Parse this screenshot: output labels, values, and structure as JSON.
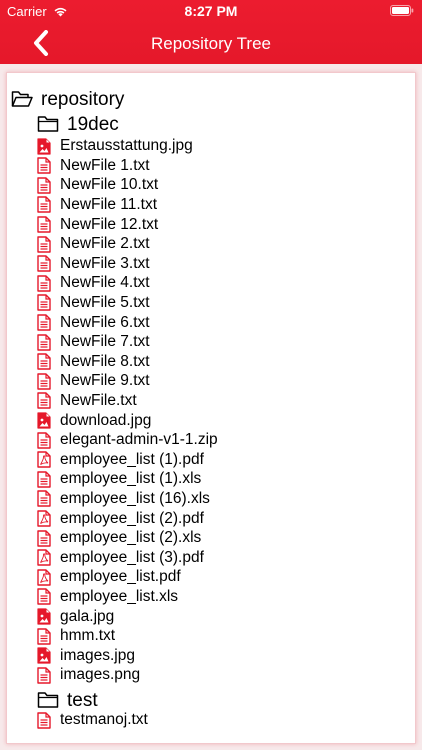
{
  "status_bar": {
    "carrier": "Carrier",
    "time": "8:27 PM"
  },
  "header": {
    "title": "Repository Tree",
    "accent_color": "#e5182a"
  },
  "tree": {
    "root": {
      "name": "repository",
      "icon": "folder-open-icon"
    },
    "folders": [
      {
        "name": "19dec",
        "icon": "folder-icon",
        "files": [
          {
            "name": "Erstausstattung.jpg",
            "icon": "image-file-icon"
          },
          {
            "name": "NewFile 1.txt",
            "icon": "text-file-icon"
          },
          {
            "name": "NewFile 10.txt",
            "icon": "text-file-icon"
          },
          {
            "name": "NewFile 11.txt",
            "icon": "text-file-icon"
          },
          {
            "name": "NewFile 12.txt",
            "icon": "text-file-icon"
          },
          {
            "name": "NewFile 2.txt",
            "icon": "text-file-icon"
          },
          {
            "name": "NewFile 3.txt",
            "icon": "text-file-icon"
          },
          {
            "name": "NewFile 4.txt",
            "icon": "text-file-icon"
          },
          {
            "name": "NewFile 5.txt",
            "icon": "text-file-icon"
          },
          {
            "name": "NewFile 6.txt",
            "icon": "text-file-icon"
          },
          {
            "name": "NewFile 7.txt",
            "icon": "text-file-icon"
          },
          {
            "name": "NewFile 8.txt",
            "icon": "text-file-icon"
          },
          {
            "name": "NewFile 9.txt",
            "icon": "text-file-icon"
          },
          {
            "name": "NewFile.txt",
            "icon": "text-file-icon"
          },
          {
            "name": "download.jpg",
            "icon": "image-file-icon"
          },
          {
            "name": "elegant-admin-v1-1.zip",
            "icon": "text-file-icon"
          },
          {
            "name": "employee_list (1).pdf",
            "icon": "pdf-file-icon"
          },
          {
            "name": "employee_list (1).xls",
            "icon": "text-file-icon"
          },
          {
            "name": "employee_list (16).xls",
            "icon": "text-file-icon"
          },
          {
            "name": "employee_list (2).pdf",
            "icon": "pdf-file-icon"
          },
          {
            "name": "employee_list (2).xls",
            "icon": "text-file-icon"
          },
          {
            "name": "employee_list (3).pdf",
            "icon": "pdf-file-icon"
          },
          {
            "name": "employee_list.pdf",
            "icon": "pdf-file-icon"
          },
          {
            "name": "employee_list.xls",
            "icon": "text-file-icon"
          },
          {
            "name": "gala.jpg",
            "icon": "image-file-icon"
          },
          {
            "name": "hmm.txt",
            "icon": "text-file-icon"
          },
          {
            "name": "images.jpg",
            "icon": "image-file-icon"
          },
          {
            "name": "images.png",
            "icon": "text-file-icon"
          }
        ]
      },
      {
        "name": "test",
        "icon": "folder-icon",
        "files": [
          {
            "name": "testmanoj.txt",
            "icon": "text-file-icon"
          }
        ]
      }
    ]
  }
}
